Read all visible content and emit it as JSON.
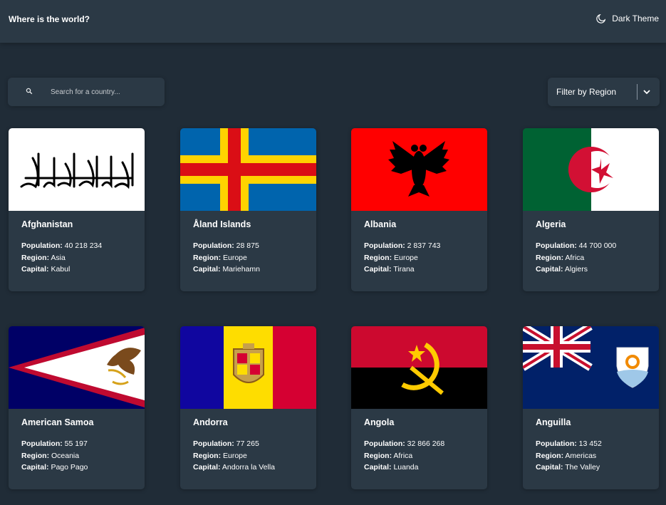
{
  "header": {
    "title": "Where is the world?",
    "theme_label": "Dark Theme"
  },
  "search": {
    "placeholder": "Search for a country..."
  },
  "filter": {
    "label": "Filter by Region"
  },
  "labels": {
    "population": "Population:",
    "region": "Region:",
    "capital": "Capital:"
  },
  "countries": [
    {
      "name": "Afghanistan",
      "population": "40 218 234",
      "region": "Asia",
      "capital": "Kabul"
    },
    {
      "name": "Åland Islands",
      "population": "28 875",
      "region": "Europe",
      "capital": "Mariehamn"
    },
    {
      "name": "Albania",
      "population": "2 837 743",
      "region": "Europe",
      "capital": "Tirana"
    },
    {
      "name": "Algeria",
      "population": "44 700 000",
      "region": "Africa",
      "capital": "Algiers"
    },
    {
      "name": "American Samoa",
      "population": "55 197",
      "region": "Oceania",
      "capital": "Pago Pago"
    },
    {
      "name": "Andorra",
      "population": "77 265",
      "region": "Europe",
      "capital": "Andorra la Vella"
    },
    {
      "name": "Angola",
      "population": "32 866 268",
      "region": "Africa",
      "capital": "Luanda"
    },
    {
      "name": "Anguilla",
      "population": "13 452",
      "region": "Americas",
      "capital": "The Valley"
    }
  ],
  "colors": {
    "background": "#202c37",
    "element": "#2b3945",
    "text": "#ffffff"
  }
}
